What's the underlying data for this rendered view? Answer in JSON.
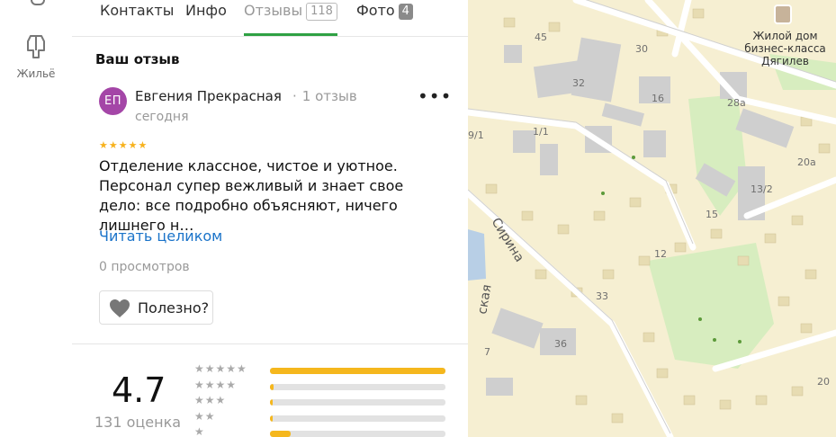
{
  "rail": {
    "home_label": "Жильё",
    "icon": "building-icon"
  },
  "tabs": [
    {
      "label": "Контакты"
    },
    {
      "label": "Инфо"
    },
    {
      "label": "Отзывы",
      "count": "118",
      "active": true
    },
    {
      "label": "Фото",
      "count": "4"
    }
  ],
  "your_review": {
    "title": "Ваш отзыв",
    "initials": "ЕП",
    "author": "Евгения Прекрасная",
    "author_reviews": "1 отзыв",
    "date": "сегодня",
    "rating": 5,
    "stars": "★★★★★",
    "text": "Отделение классное, чистое и уютное. Персонал супер вежливый и знает свое дело: все подробно объясняют, ничего лишнего н…",
    "read_more": "Читать целиком",
    "views": "0 просмотров",
    "helpful": "Полезно?"
  },
  "summary": {
    "rating": "4.7",
    "count": "131 оценка",
    "distribution": [
      {
        "stars": "★★★★★",
        "share": 1.0
      },
      {
        "stars": "★★★★",
        "share": 0.02
      },
      {
        "stars": "★★★",
        "share": 0.01
      },
      {
        "stars": "★★",
        "share": 0.01
      },
      {
        "stars": "★",
        "share": 0.12
      }
    ]
  },
  "map": {
    "poi": "Жилой дом бизнес-класса Дягилев",
    "street_1": "Сирина",
    "street_2": "ская",
    "house_numbers": [
      "45",
      "30",
      "32",
      "16",
      "28а",
      "1/1",
      "9/1",
      "20а",
      "13/2",
      "15",
      "12",
      "33",
      "36",
      "7",
      "20"
    ],
    "colors": {
      "land": "#f6efd2",
      "road": "#ffffff",
      "building": "#cfcfcf",
      "park": "#d7edbf",
      "water": "#b8cfe6",
      "accent": "#2fa143"
    }
  }
}
